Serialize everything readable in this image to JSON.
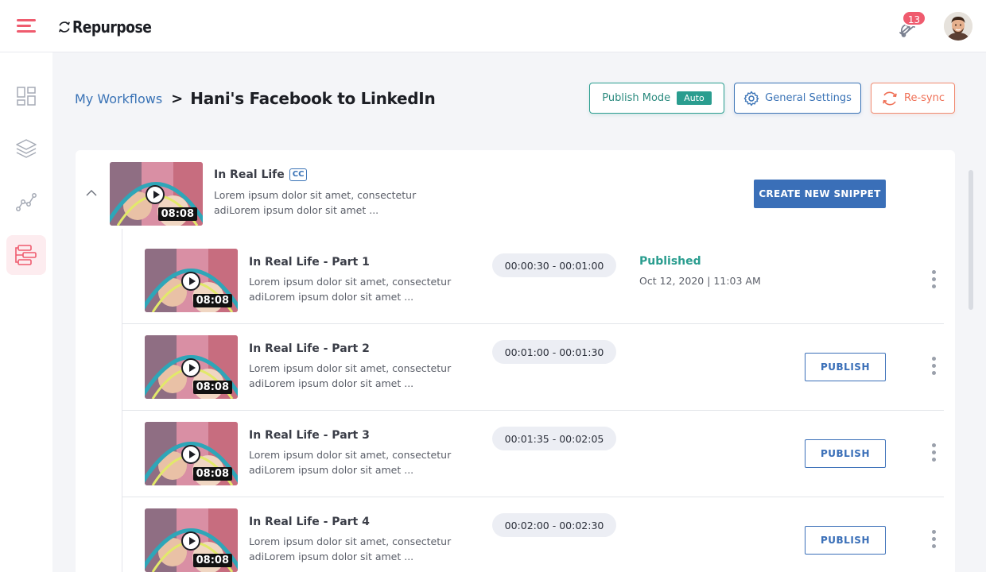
{
  "app": {
    "logo_text": "Repurpose",
    "notification_count": "13"
  },
  "sidebar": {
    "items": [
      {
        "icon": "dashboard-icon",
        "active": false
      },
      {
        "icon": "layers-icon",
        "active": false
      },
      {
        "icon": "analytics-icon",
        "active": false
      },
      {
        "icon": "workflow-icon",
        "active": true
      }
    ]
  },
  "breadcrumb": {
    "parent": "My Workflows",
    "separator": ">",
    "current": "Hani's Facebook to LinkedIn"
  },
  "header_buttons": {
    "publish_mode_label": "Publish Mode",
    "publish_mode_value": "Auto",
    "general_settings_label": "General Settings",
    "resync_label": "Re-sync"
  },
  "parent_video": {
    "title": "In Real Life",
    "cc_label": "CC",
    "desc_line1": "Lorem ipsum dolor sit amet, consectetur",
    "desc_line2": "adiLorem ipsum dolor sit amet ...",
    "duration": "08:08",
    "create_button": "CREATE NEW SNIPPET"
  },
  "snippets": [
    {
      "title": "In Real Life - Part 1",
      "desc_line1": "Lorem ipsum dolor sit amet, consectetur",
      "desc_line2": "adiLorem ipsum dolor sit amet ...",
      "duration": "08:08",
      "time_range": "00:00:30 - 00:01:00",
      "status": "Published",
      "status_date": "Oct 12, 2020  |  11:03 AM"
    },
    {
      "title": "In Real Life - Part 2",
      "desc_line1": "Lorem ipsum dolor sit amet, consectetur",
      "desc_line2": "adiLorem ipsum dolor sit amet ...",
      "duration": "08:08",
      "time_range": "00:01:00 - 00:01:30",
      "action": "PUBLISH"
    },
    {
      "title": "In Real Life - Part 3",
      "desc_line1": "Lorem ipsum dolor sit amet, consectetur",
      "desc_line2": "adiLorem ipsum dolor sit amet ...",
      "duration": "08:08",
      "time_range": "00:01:35 - 00:02:05",
      "action": "PUBLISH"
    },
    {
      "title": "In Real Life - Part 4",
      "desc_line1": "Lorem ipsum dolor sit amet, consectetur",
      "desc_line2": "adiLorem ipsum dolor sit amet ...",
      "duration": "08:08",
      "time_range": "00:02:00 - 00:02:30",
      "action": "PUBLISH"
    }
  ],
  "colors": {
    "accent_pink": "#ef5b6e",
    "primary_blue": "#3a6fb8",
    "teal": "#2a9d8f",
    "orange": "#ef6f55"
  }
}
